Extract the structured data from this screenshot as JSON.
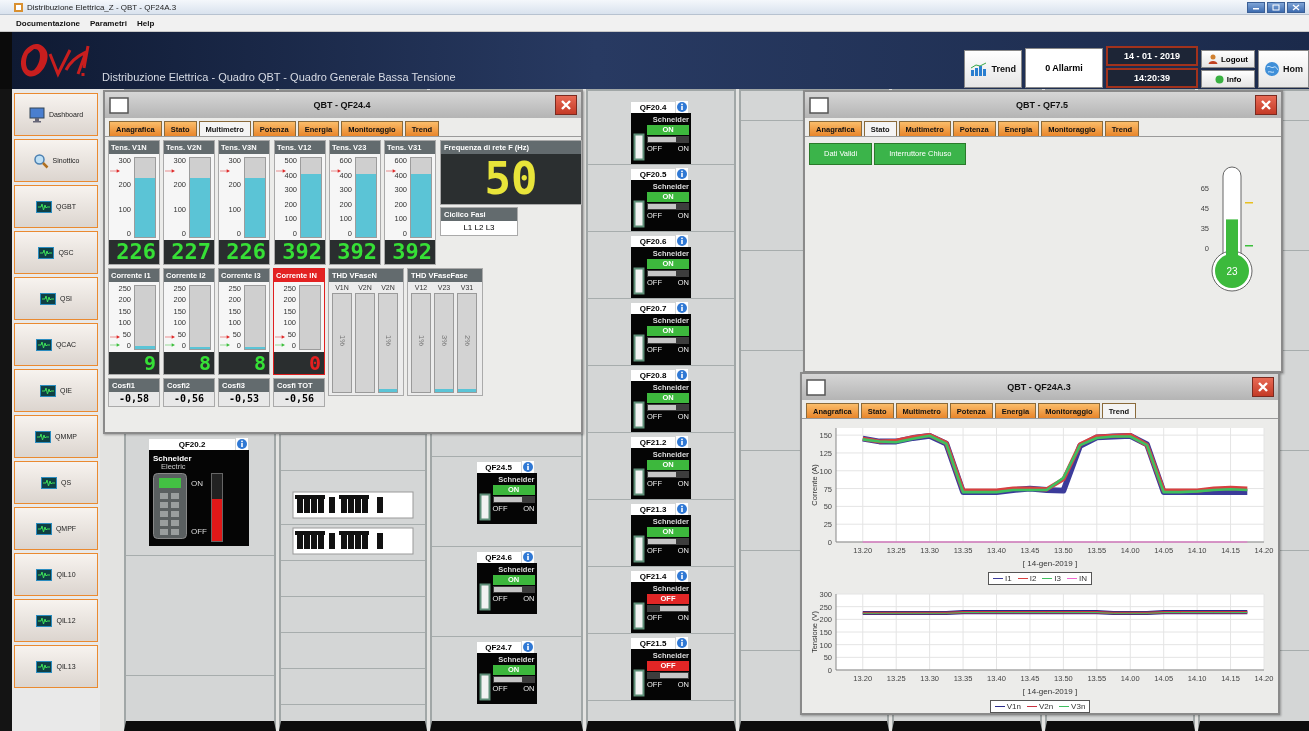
{
  "title_bar": {
    "title": "Distribuzione Elettrica_Z - QBT - QF24A.3"
  },
  "menu": [
    "Documentazione",
    "Parametri",
    "Help"
  ],
  "header": {
    "title": "Distribuzione Elettrica - Quadro QBT - Quadro Generale Bassa Tensione",
    "trend_button": "Trend",
    "alarms": "0 Allarmi",
    "date": "14 - 01 - 2019",
    "time": "14:20:39",
    "logout_button": "Logout",
    "info_button": "Info",
    "home_button": "Hom"
  },
  "sidebar": {
    "items": [
      {
        "label": "Dashboard",
        "kind": "dashboard"
      },
      {
        "label": "Sinottico",
        "kind": "search"
      },
      {
        "label": "QGBT",
        "kind": "panel"
      },
      {
        "label": "QSC",
        "kind": "panel"
      },
      {
        "label": "QSI",
        "kind": "panel"
      },
      {
        "label": "QCAC",
        "kind": "panel"
      },
      {
        "label": "QIE",
        "kind": "panel"
      },
      {
        "label": "QMMP",
        "kind": "panel"
      },
      {
        "label": "QS",
        "kind": "panel"
      },
      {
        "label": "QMPF",
        "kind": "panel"
      },
      {
        "label": "QIL10",
        "kind": "panel"
      },
      {
        "label": "QIL12",
        "kind": "panel"
      },
      {
        "label": "QIL13",
        "kind": "panel"
      }
    ]
  },
  "synoptic": {
    "cabinets": [
      {
        "items": [
          {
            "kind": "large",
            "name": "QF20.2",
            "brand": "Schneider",
            "brand_sub": "Electric",
            "handle_labels": [
              "ON",
              "OFF"
            ],
            "level": 0.62
          }
        ]
      },
      {
        "items": [
          {
            "kind": "terminals"
          },
          {
            "kind": "terminals"
          }
        ]
      },
      {
        "items": [
          {
            "kind": "compact",
            "name": "QF24.5",
            "brand": "Schneider",
            "status": "ON",
            "on": true,
            "switch_labels": [
              "OFF",
              "ON"
            ]
          },
          {
            "kind": "compact",
            "name": "QF24.6",
            "brand": "Schneider",
            "status": "ON",
            "on": true,
            "switch_labels": [
              "OFF",
              "ON"
            ]
          },
          {
            "kind": "compact",
            "name": "QF24.7",
            "brand": "Schneider",
            "status": "ON",
            "on": true,
            "switch_labels": [
              "OFF",
              "ON"
            ]
          }
        ]
      },
      {
        "items": [
          {
            "kind": "compact",
            "name": "QF20.4",
            "brand": "Schneider",
            "status": "ON",
            "on": true,
            "switch_labels": [
              "OFF",
              "ON"
            ]
          },
          {
            "kind": "compact",
            "name": "QF20.5",
            "brand": "Schneider",
            "status": "ON",
            "on": true,
            "switch_labels": [
              "OFF",
              "ON"
            ]
          },
          {
            "kind": "compact",
            "name": "QF20.6",
            "brand": "Schneider",
            "status": "ON",
            "on": true,
            "switch_labels": [
              "OFF",
              "ON"
            ]
          },
          {
            "kind": "compact",
            "name": "QF20.7",
            "brand": "Schneider",
            "status": "ON",
            "on": true,
            "switch_labels": [
              "OFF",
              "ON"
            ]
          },
          {
            "kind": "compact",
            "name": "QF20.8",
            "brand": "Schneider",
            "status": "ON",
            "on": true,
            "switch_labels": [
              "OFF",
              "ON"
            ]
          },
          {
            "kind": "compact",
            "name": "QF21.2",
            "brand": "Schneider",
            "status": "ON",
            "on": true,
            "switch_labels": [
              "OFF",
              "ON"
            ]
          },
          {
            "kind": "compact",
            "name": "QF21.3",
            "brand": "Schneider",
            "status": "ON",
            "on": true,
            "switch_labels": [
              "OFF",
              "ON"
            ]
          },
          {
            "kind": "compact",
            "name": "QF21.4",
            "brand": "Schneider",
            "status": "OFF",
            "on": false,
            "switch_labels": [
              "OFF",
              "ON"
            ]
          },
          {
            "kind": "compact",
            "name": "QF21.5",
            "brand": "Schneider",
            "status": "OFF",
            "on": false,
            "switch_labels": [
              "OFF",
              "ON"
            ]
          }
        ]
      }
    ]
  },
  "windows": [
    {
      "kind": "multimeter",
      "title": "QBT - QF24.4",
      "tabs": [
        {
          "label": "Anagrafica",
          "selected": false
        },
        {
          "label": "Stato",
          "selected": false
        },
        {
          "label": "Multimetro",
          "selected": true
        },
        {
          "label": "Potenza",
          "selected": false
        },
        {
          "label": "Energia",
          "selected": false
        },
        {
          "label": "Monitoraggio",
          "selected": false
        },
        {
          "label": "Trend",
          "selected": false
        }
      ],
      "voltage_meters": [
        {
          "label": "Tens. V1N",
          "scale": [
            "300",
            "200",
            "100",
            "0"
          ],
          "level": 0.75,
          "reading": "226",
          "alarm": false
        },
        {
          "label": "Tens. V2N",
          "scale": [
            "300",
            "200",
            "100",
            "0"
          ],
          "level": 0.75,
          "reading": "227",
          "alarm": false
        },
        {
          "label": "Tens. V3N",
          "scale": [
            "300",
            "200",
            "100",
            "0"
          ],
          "level": 0.75,
          "reading": "226",
          "alarm": false
        },
        {
          "label": "Tens. V12",
          "scale": [
            "500",
            "400",
            "300",
            "200",
            "100",
            "0"
          ],
          "level": 0.8,
          "reading": "392",
          "alarm": false
        },
        {
          "label": "Tens. V23",
          "scale": [
            "600",
            "400",
            "300",
            "200",
            "100",
            "0"
          ],
          "level": 0.8,
          "reading": "392",
          "alarm": false
        },
        {
          "label": "Tens. V31",
          "scale": [
            "600",
            "400",
            "300",
            "200",
            "100",
            "0"
          ],
          "level": 0.8,
          "reading": "392",
          "alarm": false
        }
      ],
      "frequency": {
        "label": "Frequenza di rete F (Hz)",
        "reading": "50"
      },
      "phase_cycle": {
        "label": "Ciclico Fasi",
        "value": "L1 L2 L3"
      },
      "current_meters": [
        {
          "label": "Corrente I1",
          "scale": [
            "250",
            "200",
            "150",
            "100",
            "50",
            "0"
          ],
          "level": 0.04,
          "reading": "9",
          "alarm": false
        },
        {
          "label": "Corrente I2",
          "scale": [
            "250",
            "200",
            "150",
            "100",
            "50",
            "0"
          ],
          "level": 0.03,
          "reading": "8",
          "alarm": false
        },
        {
          "label": "Corrente I3",
          "scale": [
            "250",
            "200",
            "150",
            "100",
            "50",
            "0"
          ],
          "level": 0.03,
          "reading": "8",
          "alarm": false
        },
        {
          "label": "Corrente IN",
          "scale": [
            "250",
            "200",
            "150",
            "100",
            "50",
            "0"
          ],
          "level": 0,
          "reading": "0",
          "alarm": true
        }
      ],
      "thd_groups": [
        {
          "title": "THD VFaseN",
          "bars": [
            {
              "label": "V1N",
              "reading": "1%",
              "level": 0
            },
            {
              "label": "V2N",
              "level": 0
            },
            {
              "label": "V2N",
              "reading": "1%",
              "level": 0.03
            }
          ]
        },
        {
          "title": "THD VFaseFase",
          "bars": [
            {
              "label": "V12",
              "reading": "1%",
              "level": 0
            },
            {
              "label": "V23",
              "reading": "3%",
              "level": 0.03
            },
            {
              "label": "V31",
              "reading": "2%",
              "level": 0.03
            }
          ]
        }
      ],
      "cosfi": [
        {
          "label": "Cosfi1",
          "value": "-0,58"
        },
        {
          "label": "Cosfi2",
          "value": "-0,56"
        },
        {
          "label": "Cosfi3",
          "value": "-0,53"
        },
        {
          "label": "Cosfi TOT",
          "value": "-0,56"
        }
      ]
    },
    {
      "kind": "status",
      "title": "QBT - QF7.5",
      "tabs": [
        {
          "label": "Anagrafica",
          "selected": false
        },
        {
          "label": "Stato",
          "selected": true
        },
        {
          "label": "Multimetro",
          "selected": false
        },
        {
          "label": "Potenza",
          "selected": false
        },
        {
          "label": "Energia",
          "selected": false
        },
        {
          "label": "Monitoraggio",
          "selected": false
        },
        {
          "label": "Trend",
          "selected": false
        }
      ],
      "indicators": [
        {
          "label": "Dati Validi",
          "active": true
        },
        {
          "label": "Interruttore Chiuso",
          "active": true
        }
      ],
      "thermometer": {
        "ticks": [
          "65",
          "45",
          "35",
          "0"
        ],
        "level": 0.42,
        "reading": "23"
      }
    },
    {
      "kind": "trend",
      "title": "QBT - QF24A.3",
      "tabs": [
        {
          "label": "Anagrafica",
          "selected": false
        },
        {
          "label": "Stato",
          "selected": false
        },
        {
          "label": "Multimetro",
          "selected": false
        },
        {
          "label": "Potenza",
          "selected": false
        },
        {
          "label": "Energia",
          "selected": false
        },
        {
          "label": "Monitoraggio",
          "selected": false
        },
        {
          "label": "Trend",
          "selected": true
        }
      ],
      "charts": [
        {
          "chart_data": {
            "type": "line",
            "xlabel": "[ 14-gen-2019 ]",
            "ylabel": "Corrente (A)",
            "ylim": [
              0,
              160
            ],
            "grid": true,
            "legend": "bottom",
            "categories": [
              null,
              "13.20",
              null,
              "13.25",
              null,
              "13.30",
              null,
              "13.35",
              null,
              "13.40",
              null,
              "13.45",
              null,
              "13.50",
              null,
              "13.55",
              null,
              "14.00",
              null,
              "14.05",
              null,
              "14.10",
              null,
              "14.15",
              null,
              "14.20"
            ],
            "yticks": [
              0,
              25,
              50,
              75,
              100,
              125,
              150
            ],
            "series": [
              {
                "name": "I1",
                "color": "#3b3b9a",
                "values": [
                  null,
                  145,
                  141,
                  141,
                  146,
                  149,
                  138,
                  70,
                  70,
                  70,
                  73,
                  75,
                  73,
                  72,
                  135,
                  147,
                  148,
                  149,
                  137,
                  70,
                  70,
                  70,
                  70,
                  70,
                  70,
                  null
                ]
              },
              {
                "name": "I2",
                "color": "#d84040",
                "values": [
                  null,
                  145,
                  141,
                  142,
                  147,
                  150,
                  139,
                  72,
                  72,
                  72,
                  75,
                  75,
                  74,
                  88,
                  137,
                  148,
                  149,
                  150,
                  136,
                  72,
                  72,
                  72,
                  75,
                  76,
                  75,
                  null
                ]
              },
              {
                "name": "I3",
                "color": "#3fbf5f",
                "values": [
                  null,
                  144,
                  141,
                  140,
                  145,
                  149,
                  138,
                  70,
                  70,
                  70,
                  73,
                  73,
                  73,
                  90,
                  136,
                  146,
                  148,
                  148,
                  136,
                  70,
                  70,
                  71,
                  73,
                  74,
                  73,
                  null
                ]
              },
              {
                "name": "IN",
                "color": "#f06ad0",
                "values": [
                  null,
                  0,
                  0,
                  0,
                  0,
                  0,
                  0,
                  0,
                  0,
                  0,
                  0,
                  0,
                  0,
                  0,
                  0,
                  0,
                  0,
                  0,
                  0,
                  0,
                  0,
                  0,
                  0,
                  0,
                  0,
                  null
                ]
              }
            ]
          }
        },
        {
          "chart_data": {
            "type": "line",
            "xlabel": "[ 14-gen-2019 ]",
            "ylabel": "Tensione (V)",
            "ylim": [
              0,
              300
            ],
            "grid": true,
            "legend": "bottom",
            "categories": [
              null,
              "13.20",
              null,
              "13.25",
              null,
              "13.30",
              null,
              "13.35",
              null,
              "13.40",
              null,
              "13.45",
              null,
              "13.50",
              null,
              "13.55",
              null,
              "14.00",
              null,
              "14.05",
              null,
              "14.10",
              null,
              "14.15",
              null,
              "14.20"
            ],
            "yticks": [
              0,
              50,
              100,
              150,
              200,
              250,
              300
            ],
            "series": [
              {
                "name": "V1n",
                "color": "#2a2a8a",
                "values": [
                  null,
                  225,
                  225,
                  225,
                  225,
                  225,
                  225,
                  228,
                  228,
                  228,
                  228,
                  228,
                  228,
                  228,
                  228,
                  228,
                  225,
                  225,
                  225,
                  228,
                  228,
                  228,
                  228,
                  228,
                  228,
                  null
                ]
              },
              {
                "name": "V2n",
                "color": "#c83040",
                "values": [
                  null,
                  225,
                  225,
                  225,
                  225,
                  225,
                  225,
                  228,
                  228,
                  228,
                  228,
                  228,
                  228,
                  228,
                  228,
                  228,
                  225,
                  225,
                  225,
                  228,
                  228,
                  228,
                  228,
                  228,
                  228,
                  null
                ]
              },
              {
                "name": "V3n",
                "color": "#3fbf5f",
                "values": [
                  null,
                  224,
                  224,
                  224,
                  224,
                  224,
                  224,
                  227,
                  227,
                  227,
                  227,
                  227,
                  227,
                  227,
                  227,
                  227,
                  224,
                  224,
                  224,
                  227,
                  227,
                  227,
                  227,
                  227,
                  227,
                  null
                ]
              }
            ]
          }
        }
      ]
    }
  ]
}
